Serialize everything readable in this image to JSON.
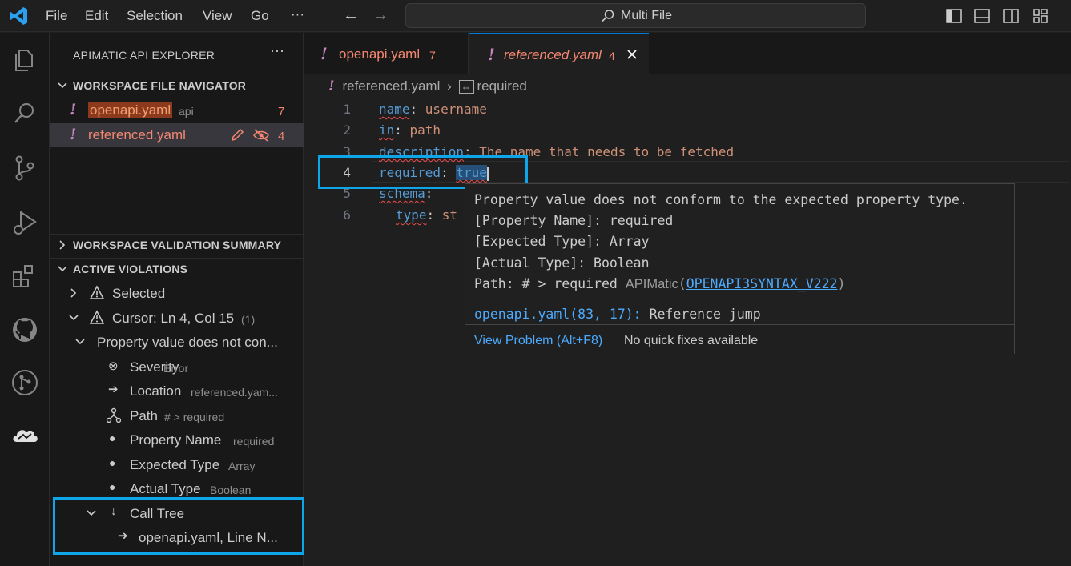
{
  "titlebar": {
    "menu": [
      "File",
      "Edit",
      "Selection",
      "View",
      "Go"
    ],
    "more": "···",
    "search_text": "Multi File"
  },
  "sidebar": {
    "title": "APIMATIC API EXPLORER",
    "more": "···",
    "file_navigator": {
      "heading": "WORKSPACE FILE NAVIGATOR",
      "files": [
        {
          "name": "openapi.yaml",
          "desc": "api",
          "count": "7"
        },
        {
          "name": "referenced.yaml",
          "count": "4"
        }
      ]
    },
    "validation_summary_heading": "WORKSPACE VALIDATION SUMMARY",
    "violations": {
      "heading": "ACTIVE VIOLATIONS",
      "selected_label": "Selected",
      "cursor_label": "Cursor: Ln 4, Col 15",
      "cursor_count": "(1)",
      "violation_label": "Property value does not con...",
      "details": [
        {
          "label": "Severity",
          "value": "Error",
          "icon": "error-circle-icon"
        },
        {
          "label": "Location",
          "value": "referenced.yam...",
          "icon": "arrow-right-icon"
        },
        {
          "label": "Path",
          "value": "# > required",
          "icon": "type-hierarchy-icon"
        },
        {
          "label": "Property Name",
          "value": "required",
          "icon": "bullet-icon"
        },
        {
          "label": "Expected Type",
          "value": "Array",
          "icon": "bullet-icon"
        },
        {
          "label": "Actual Type",
          "value": "Boolean",
          "icon": "bullet-icon"
        }
      ],
      "call_tree_label": "Call Tree",
      "call_tree_child": "openapi.yaml, Line N..."
    }
  },
  "editor": {
    "tabs": [
      {
        "name": "openapi.yaml",
        "count": "7"
      },
      {
        "name": "referenced.yaml",
        "count": "4"
      }
    ],
    "breadcrumb": {
      "file": "referenced.yaml",
      "symbol": "required"
    },
    "lines": [
      {
        "num": "1",
        "key": "name",
        "value": "username"
      },
      {
        "num": "2",
        "key": "in",
        "value": "path"
      },
      {
        "num": "3",
        "key": "description",
        "value": "The name that needs to be fetched"
      },
      {
        "num": "4",
        "key": "required",
        "value": "true"
      },
      {
        "num": "5",
        "key": "schema",
        "value": ""
      },
      {
        "num": "6",
        "key": "type",
        "value": "st"
      }
    ]
  },
  "hover": {
    "line1": "Property value does not conform to the expected property type.",
    "line2": "[Property Name]: required",
    "line3": "[Expected Type]: Array",
    "line4": "[Actual Type]: Boolean",
    "line5_prefix": "Path: # > required",
    "source": "APIMatic",
    "code": "OPENAPI3SYNTAX_V222",
    "related_loc": "openapi.yaml(83, 17):",
    "related_msg": "Reference jump",
    "view_problem": "View Problem (Alt+F8)",
    "no_fixes": "No quick fixes available"
  },
  "colors": {
    "accent_highlight": "#0ea5e9",
    "error": "#f48771",
    "warning_icon": "#c586c0",
    "yaml_key": "#569cd6",
    "yaml_value": "#ce9178"
  }
}
